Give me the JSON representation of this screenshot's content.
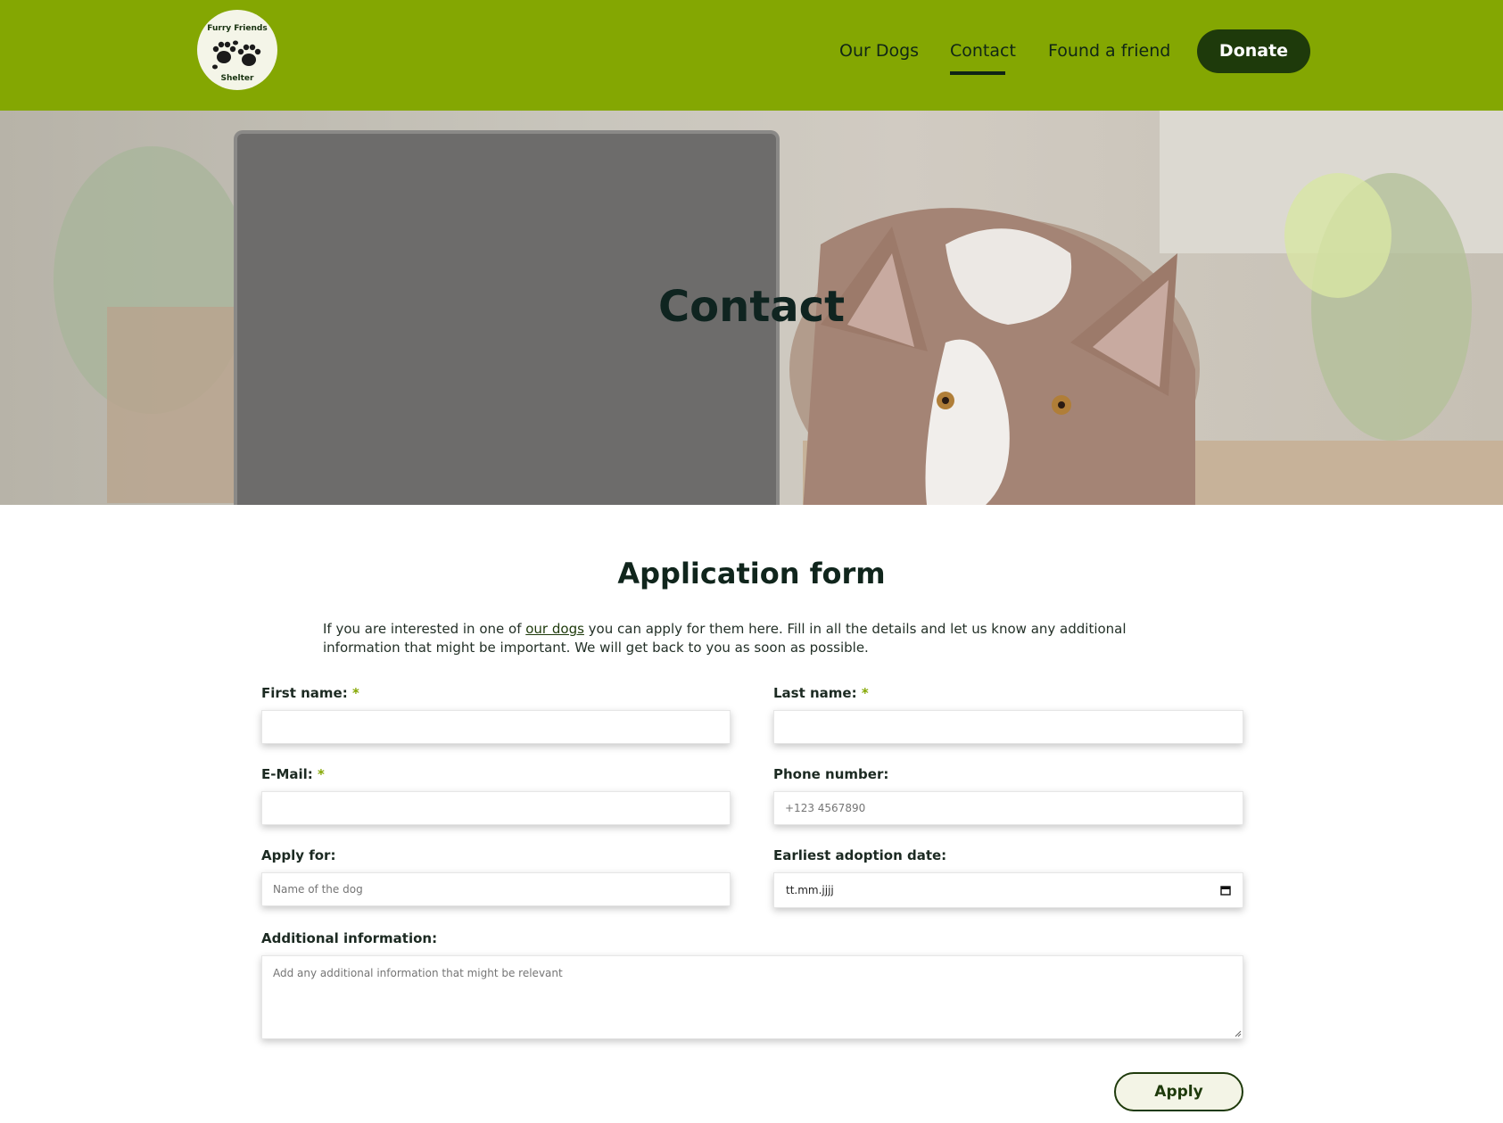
{
  "header": {
    "logo_top": "Furry Friends",
    "logo_bottom": "Shelter",
    "nav": {
      "our_dogs": "Our Dogs",
      "contact": "Contact",
      "found_friend": "Found a friend",
      "donate": "Donate"
    },
    "colors": {
      "header_bg": "#84a702",
      "donate_bg": "#1e3a0b"
    }
  },
  "hero": {
    "title": "Contact"
  },
  "form": {
    "title": "Application form",
    "intro_before": "If you are interested in one of ",
    "intro_link": "our dogs",
    "intro_after": " you can apply for them here. Fill in all the details and let us know any additional information that might be important. We will get back to you as soon as possible.",
    "required_mark": "*",
    "first_name_label": "First name:",
    "last_name_label": "Last name:",
    "email_label": "E-Mail:",
    "phone_label": "Phone number:",
    "phone_placeholder": "+123 4567890",
    "apply_for_label": "Apply for:",
    "apply_for_placeholder": "Name of the dog",
    "date_label": "Earliest adoption date:",
    "date_placeholder": "tt.mm.jjjj",
    "additional_label": "Additional information:",
    "additional_placeholder": "Add any additional information that might be relevant",
    "apply_button": "Apply"
  }
}
